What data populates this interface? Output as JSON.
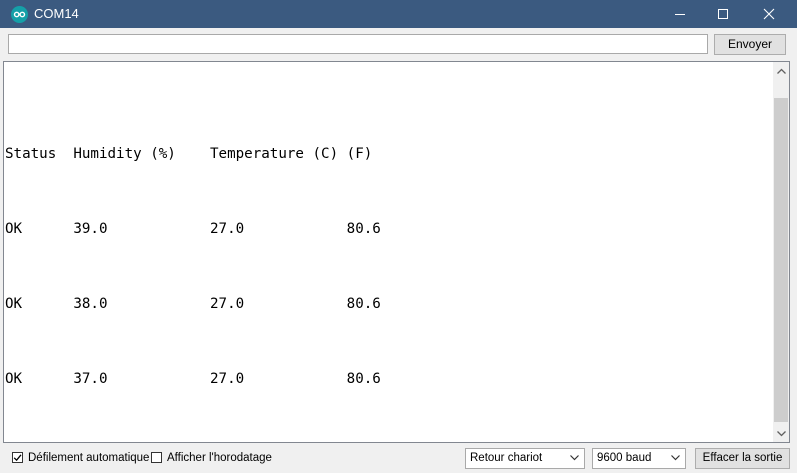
{
  "window": {
    "title": "COM14"
  },
  "send": {
    "input_value": "",
    "button_label": "Envoyer"
  },
  "output": {
    "lines": [
      "Status  Humidity (%)    Temperature (C) (F)",
      "OK      39.0            27.0            80.6",
      "OK      38.0            27.0            80.6",
      "OK      37.0            27.0            80.6"
    ]
  },
  "footer": {
    "autoscroll_label": "Défilement automatique",
    "autoscroll_checked": true,
    "timestamp_label": "Afficher l'horodatage",
    "timestamp_checked": false,
    "line_ending": "Retour chariot",
    "baud": "9600 baud",
    "clear_label": "Effacer la sortie"
  },
  "colors": {
    "titlebar": "#3b5a80",
    "app_icon": "#15a0a8"
  }
}
